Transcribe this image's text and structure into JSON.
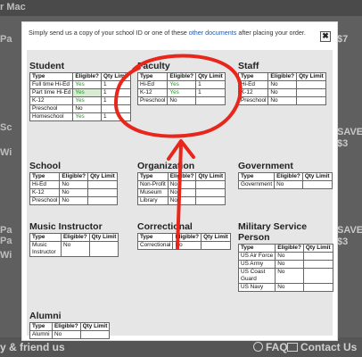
{
  "background": {
    "top_text": "r Mac",
    "side_texts": [
      "Pa",
      "Sc",
      "Wi",
      "Pa",
      "Pa",
      "Wi"
    ],
    "right_badges": [
      "$7",
      "SAVE",
      "$3",
      "SAVE",
      "$3"
    ],
    "footer": {
      "left": "y & friend us",
      "faq": "FAQ",
      "contact": "Contact Us"
    }
  },
  "modal": {
    "message_before": "Simply send us a copy of your school ID or one of these ",
    "message_link": "other documents",
    "message_after": " after placing your order.",
    "close_label": "✖",
    "headers": {
      "type": "Type",
      "eligible": "Eligible?",
      "qty": "Qty Limit"
    },
    "groups": {
      "student": {
        "title": "Student",
        "rows": [
          {
            "type": "Full time Hi-Ed",
            "eligible": "Yes",
            "qty": "1"
          },
          {
            "type": "Part time Hi-Ed",
            "eligible": "Yes",
            "qty": "1"
          },
          {
            "type": "K-12",
            "eligible": "Yes",
            "qty": "1"
          },
          {
            "type": "Preschool",
            "eligible": "No",
            "qty": ""
          },
          {
            "type": "Homeschool",
            "eligible": "Yes",
            "qty": "1"
          }
        ]
      },
      "faculty": {
        "title": "Faculty",
        "rows": [
          {
            "type": "Hi-Ed",
            "eligible": "Yes",
            "qty": "1"
          },
          {
            "type": "K-12",
            "eligible": "Yes",
            "qty": "1"
          },
          {
            "type": "Preschool",
            "eligible": "No",
            "qty": ""
          }
        ]
      },
      "staff": {
        "title": "Staff",
        "rows": [
          {
            "type": "Hi-Ed",
            "eligible": "No",
            "qty": ""
          },
          {
            "type": "K-12",
            "eligible": "No",
            "qty": ""
          },
          {
            "type": "Preschool",
            "eligible": "No",
            "qty": ""
          }
        ]
      },
      "school": {
        "title": "School",
        "rows": [
          {
            "type": "Hi-Ed",
            "eligible": "No",
            "qty": ""
          },
          {
            "type": "K-12",
            "eligible": "No",
            "qty": ""
          },
          {
            "type": "Preschool",
            "eligible": "No",
            "qty": ""
          }
        ]
      },
      "organization": {
        "title": "Organization",
        "rows": [
          {
            "type": "Non-Profit",
            "eligible": "No",
            "qty": ""
          },
          {
            "type": "Museum",
            "eligible": "No",
            "qty": ""
          },
          {
            "type": "Library",
            "eligible": "No",
            "qty": ""
          }
        ]
      },
      "government": {
        "title": "Government",
        "rows": [
          {
            "type": "Government",
            "eligible": "No",
            "qty": ""
          }
        ]
      },
      "music": {
        "title": "Music Instructor",
        "rows": [
          {
            "type": "Music Instructor",
            "eligible": "No",
            "qty": ""
          }
        ]
      },
      "correctional": {
        "title": "Correctional",
        "rows": [
          {
            "type": "Correctional",
            "eligible": "No",
            "qty": ""
          }
        ]
      },
      "military": {
        "title": "Military Service Person",
        "rows": [
          {
            "type": "US Air Force",
            "eligible": "No",
            "qty": ""
          },
          {
            "type": "US Army",
            "eligible": "No",
            "qty": ""
          },
          {
            "type": "US Coast Guard",
            "eligible": "No",
            "qty": ""
          },
          {
            "type": "US Navy",
            "eligible": "No",
            "qty": ""
          }
        ]
      },
      "alumni": {
        "title": "Alumni",
        "rows": [
          {
            "type": "Alumni",
            "eligible": "No",
            "qty": ""
          }
        ]
      }
    }
  },
  "annotation": {
    "circle_color": "#e8261b",
    "arrow_color": "#e8261b"
  }
}
